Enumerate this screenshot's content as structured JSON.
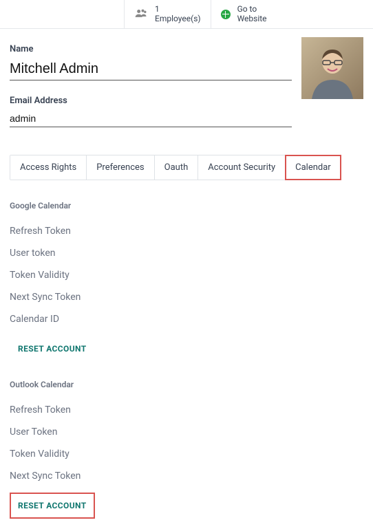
{
  "topbar": {
    "employees": {
      "count": "1",
      "label": "Employee(s)"
    },
    "website": {
      "line1": "Go to",
      "line2": "Website"
    }
  },
  "form": {
    "name_label": "Name",
    "name_value": "Mitchell Admin",
    "email_label": "Email Address",
    "email_value": "admin"
  },
  "tabs": [
    {
      "label": "Access Rights"
    },
    {
      "label": "Preferences"
    },
    {
      "label": "Oauth"
    },
    {
      "label": "Account Security"
    },
    {
      "label": "Calendar"
    }
  ],
  "google": {
    "title": "Google Calendar",
    "fields": [
      "Refresh Token",
      "User token",
      "Token Validity",
      "Next Sync Token",
      "Calendar ID"
    ],
    "reset": "RESET ACCOUNT"
  },
  "outlook": {
    "title": "Outlook Calendar",
    "fields": [
      "Refresh Token",
      "User Token",
      "Token Validity",
      "Next Sync Token"
    ],
    "reset": "RESET ACCOUNT"
  }
}
